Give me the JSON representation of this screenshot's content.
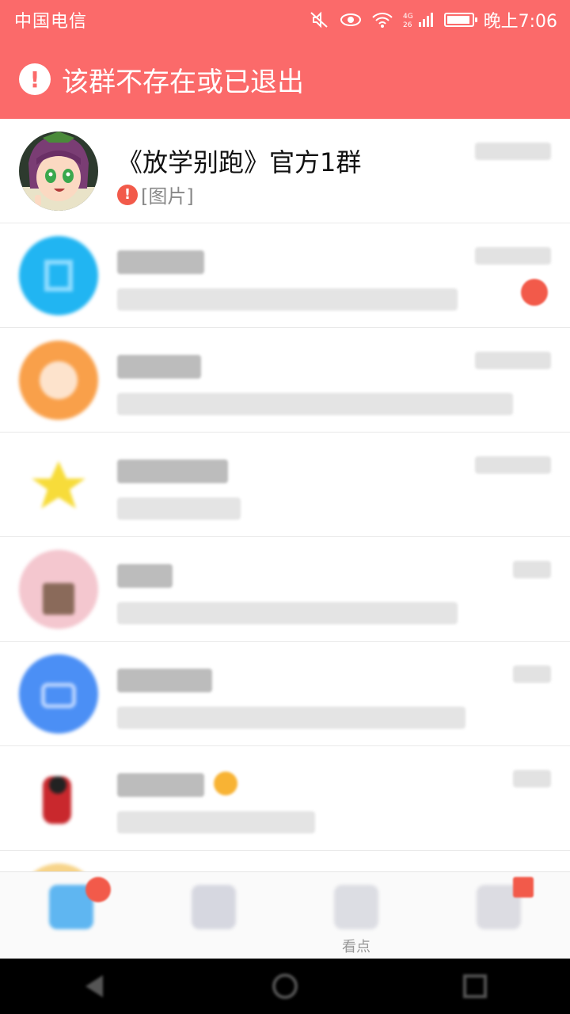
{
  "status_bar": {
    "carrier": "中国电信",
    "network": "4G 26",
    "time": "晚上7:06"
  },
  "banner": {
    "icon": "alert-circle-icon",
    "text": "该群不存在或已退出",
    "color": "#fb6a6a"
  },
  "chats": [
    {
      "name": "《放学别跑》官方1群",
      "message": "[图片]",
      "status_icon": "send-failed-icon",
      "avatar": "anime-character-avatar"
    }
  ],
  "tabs": [
    {
      "label": "",
      "icon": "message-icon",
      "badge": true
    },
    {
      "label": "",
      "icon": "contacts-icon",
      "badge": false
    },
    {
      "label": "看点",
      "icon": "watch-icon",
      "badge": false
    },
    {
      "label": "",
      "icon": "dynamic-icon",
      "badge": true
    }
  ],
  "colors": {
    "accent": "#fb6a6a",
    "badge": "#f25a4a"
  }
}
